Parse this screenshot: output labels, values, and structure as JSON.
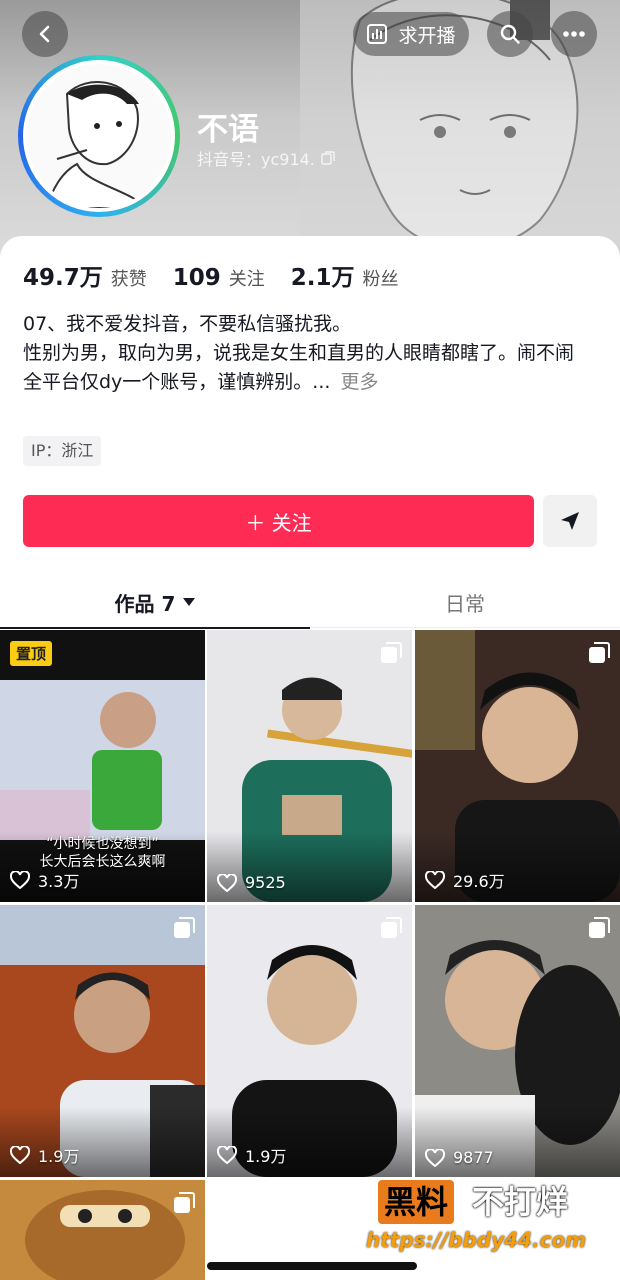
{
  "header": {
    "back_icon": "chevron-left-icon",
    "live_label": "求开播",
    "live_icon": "bar-chart-icon",
    "search_icon": "search-icon",
    "more_icon": "more-dots-icon"
  },
  "profile": {
    "nickname": "不语",
    "douyin_id": "抖音号：yc914.",
    "copy_icon": "copy-icon"
  },
  "stats": [
    {
      "value": "49.7万",
      "label": "获赞"
    },
    {
      "value": "109",
      "label": "关注"
    },
    {
      "value": "2.1万",
      "label": "粉丝"
    }
  ],
  "bio": {
    "lines": [
      "07、我不爱发抖音，不要私信骚扰我。",
      "性别为男，取向为男，说我是女生和直男的人眼睛都瞎了。闹不闹",
      "全平台仅dy一个账号，谨慎辨别。..."
    ],
    "more_label": "更多"
  },
  "ip_tag": "IP：浙江",
  "actions": {
    "follow_label": "＋ 关注",
    "follow_color": "#fe2c55",
    "share_icon": "send-icon"
  },
  "tabs": [
    {
      "label": "作品 7",
      "active": true
    },
    {
      "label": "日常",
      "active": false
    }
  ],
  "posts": [
    {
      "likes": "3.3万",
      "pinned": "置顶",
      "caption_1": "“小时候也没想到”",
      "caption_2": "长大后会长这么爽啊"
    },
    {
      "likes": "9525"
    },
    {
      "likes": "29.6万"
    },
    {
      "likes": "1.9万"
    },
    {
      "likes": "1.9万"
    },
    {
      "likes": "9877"
    },
    {
      "likes": ""
    }
  ],
  "watermark": {
    "brand_box": "黑料",
    "brand_text": "不打烊",
    "url": "https://bbdy44.com"
  }
}
